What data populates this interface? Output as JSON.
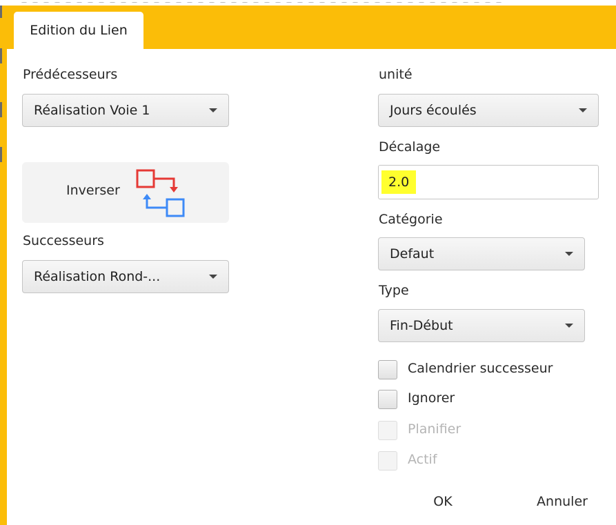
{
  "window": {
    "tab_title": "Edition du Lien"
  },
  "left": {
    "predecessors_label": "Prédécesseurs",
    "predecessors_value": "Réalisation Voie 1",
    "invert_label": "Inverser",
    "successors_label": "Successeurs",
    "successors_value": "Réalisation Rond-..."
  },
  "right": {
    "unit_label": "unité",
    "unit_value": "Jours écoulés",
    "offset_label": "Décalage",
    "offset_value": "2.0",
    "category_label": "Catégorie",
    "category_value": "Defaut",
    "type_label": "Type",
    "type_value": "Fin-Début"
  },
  "checkboxes": [
    {
      "label": "Calendrier successeur",
      "checked": false,
      "enabled": true
    },
    {
      "label": "Ignorer",
      "checked": false,
      "enabled": true
    },
    {
      "label": "Planifier",
      "checked": false,
      "enabled": false
    },
    {
      "label": "Actif",
      "checked": false,
      "enabled": false
    }
  ],
  "buttons": {
    "ok": "OK",
    "cancel": "Annuler"
  },
  "colors": {
    "accent_yellow": "#fbbd08",
    "highlight_yellow": "#ffff2e",
    "icon_red": "#e53935",
    "icon_blue": "#3d8af7"
  },
  "icons": {
    "invert_icon": "swap-boxes-icon",
    "combo_arrow": "chevron-down-icon"
  }
}
